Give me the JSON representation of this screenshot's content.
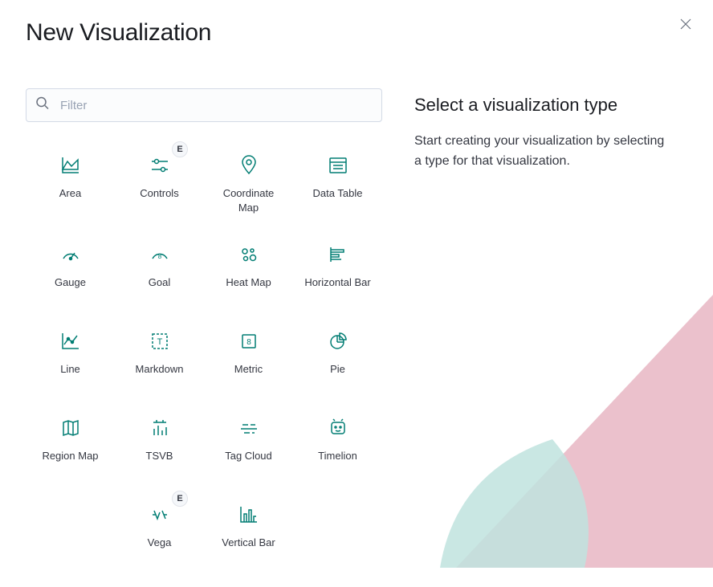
{
  "title": "New Visualization",
  "filter": {
    "placeholder": "Filter"
  },
  "instructions": {
    "heading": "Select a visualization type",
    "body": "Start creating your visualization by selecting a type for that visualization."
  },
  "badge_label": "E",
  "viz": {
    "area": "Area",
    "controls": "Controls",
    "coordinate_map": "Coordinate Map",
    "data_table": "Data Table",
    "gauge": "Gauge",
    "goal": "Goal",
    "heat_map": "Heat Map",
    "horizontal_bar": "Horizontal Bar",
    "line": "Line",
    "markdown": "Markdown",
    "metric": "Metric",
    "pie": "Pie",
    "region_map": "Region Map",
    "tsvb": "TSVB",
    "tag_cloud": "Tag Cloud",
    "timelion": "Timelion",
    "vega": "Vega",
    "vertical_bar": "Vertical Bar"
  }
}
